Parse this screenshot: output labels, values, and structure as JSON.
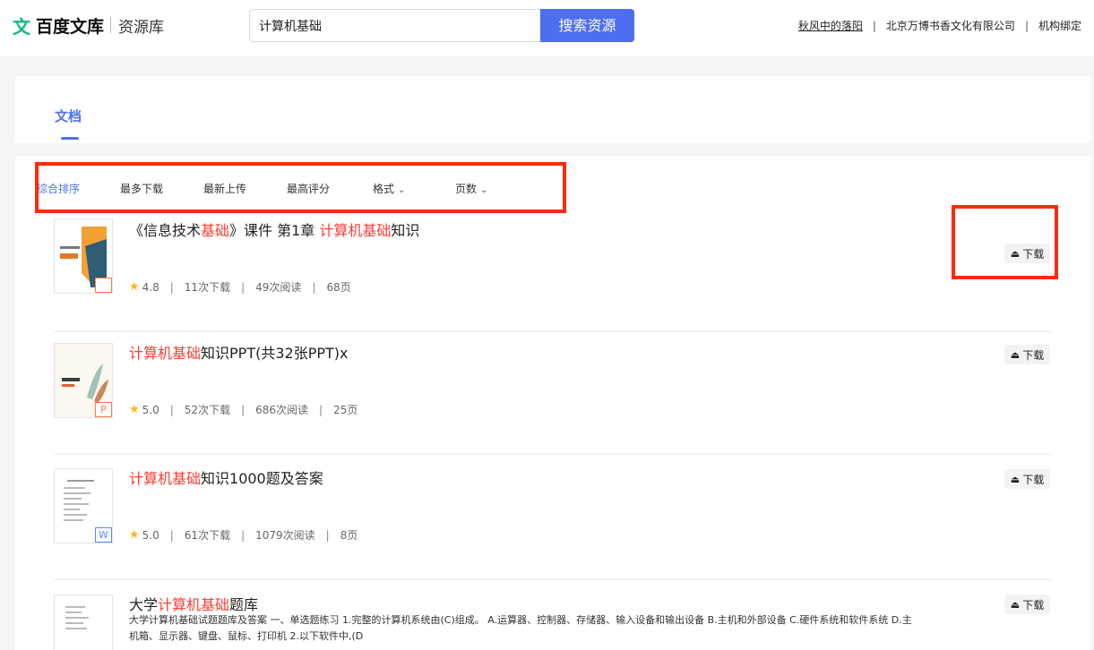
{
  "header": {
    "logo_mark": "文",
    "logo_text": "百度文库",
    "logo_sub": "资源库",
    "search_value": "计算机基础",
    "search_button": "搜索资源",
    "user_name": "秋风中的落阳",
    "separator": "|",
    "org_name": "北京万博书香文化有限公司",
    "org_bind": "机构绑定"
  },
  "tabs": {
    "doc_label": "文档"
  },
  "sort": {
    "comprehensive": "综合排序",
    "most_downloads": "最多下载",
    "latest_upload": "最新上传",
    "top_rated": "最高评分",
    "format": "格式",
    "pages": "页数"
  },
  "results": [
    {
      "title_pre": "《信息技术",
      "title_hl1": "基础",
      "title_mid": "》课件 第1章 ",
      "title_hl2": "计算机基础",
      "title_post": "知识",
      "badge": "",
      "badge_color": "#ff7a45",
      "rating": "4.8",
      "downloads": "11次下载",
      "reads": "49次阅读",
      "pages": "68页",
      "download_label": "下载"
    },
    {
      "title_pre": "",
      "title_hl1": "计算机基础",
      "title_mid": "知识PPT(共32张PPT)x",
      "title_hl2": "",
      "title_post": "",
      "badge": "P",
      "badge_color": "#ff7a45",
      "rating": "5.0",
      "downloads": "52次下载",
      "reads": "686次阅读",
      "pages": "25页",
      "download_label": "下载"
    },
    {
      "title_pre": "",
      "title_hl1": "计算机基础",
      "title_mid": "知识1000题及答案",
      "title_hl2": "",
      "title_post": "",
      "badge": "W",
      "badge_color": "#4e8ef2",
      "rating": "5.0",
      "downloads": "61次下载",
      "reads": "1079次阅读",
      "pages": "8页",
      "download_label": "下载"
    },
    {
      "title_pre": "大学",
      "title_hl1": "计算机基础",
      "title_mid": "题库",
      "title_hl2": "",
      "title_post": "",
      "desc": "大学计算机基础试题题库及答案 一、单选题练习 1.完整的计算机系统由(C)组成。 A.运算器、控制器、存储器、输入设备和输出设备 B.主机和外部设备 C.硬件系统和软件系统 D.主机箱、显示器、键盘、鼠标、打印机 2.以下软件中,(D",
      "download_label": "下载"
    }
  ],
  "colors": {
    "accent": "#4e6ef2",
    "highlight": "#ff3b30",
    "annotation": "#ff2a0a",
    "star": "#ffb81f"
  },
  "icons": {
    "download": "download-icon",
    "star": "star-icon",
    "chevron": "chevron-down-icon"
  }
}
